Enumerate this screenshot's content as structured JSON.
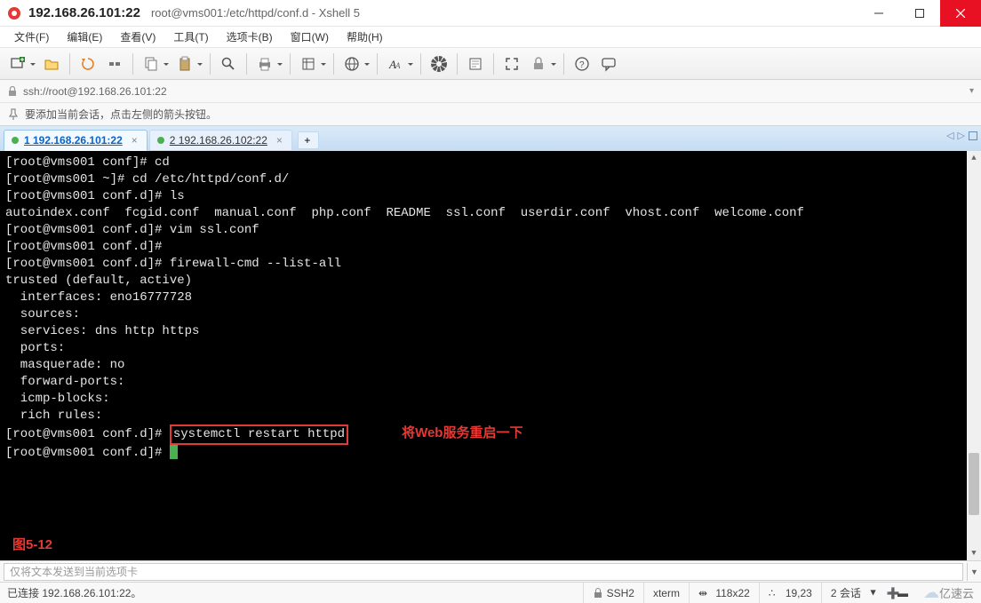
{
  "title_bar": {
    "host": "192.168.26.101:22",
    "subtitle": "root@vms001:/etc/httpd/conf.d - Xshell 5"
  },
  "menu": {
    "file": "文件(F)",
    "edit": "编辑(E)",
    "view": "查看(V)",
    "tools": "工具(T)",
    "tabs": "选项卡(B)",
    "window": "窗口(W)",
    "help": "帮助(H)"
  },
  "address": "ssh://root@192.168.26.101:22",
  "hint": "要添加当前会话，点击左侧的箭头按钮。",
  "tabs": {
    "active": "1 192.168.26.101:22",
    "inactive": "2 192.168.26.102:22",
    "add": "+"
  },
  "terminal": {
    "l1": "[root@vms001 conf]# cd",
    "l2": "[root@vms001 ~]# cd /etc/httpd/conf.d/",
    "l3": "[root@vms001 conf.d]# ls",
    "l4": "autoindex.conf  fcgid.conf  manual.conf  php.conf  README  ssl.conf  userdir.conf  vhost.conf  welcome.conf",
    "l5": "[root@vms001 conf.d]# vim ssl.conf",
    "l6": "[root@vms001 conf.d]# ",
    "l7": "[root@vms001 conf.d]# firewall-cmd --list-all",
    "l8": "trusted (default, active)",
    "l9": "  interfaces: eno16777728",
    "l10": "  sources: ",
    "l11": "  services: dns http https",
    "l12": "  ports: ",
    "l13": "  masquerade: no",
    "l14": "  forward-ports: ",
    "l15": "  icmp-blocks: ",
    "l16": "  rich rules: ",
    "l17": "",
    "l18_prompt": "[root@vms001 conf.d]# ",
    "l18_cmd": "systemctl restart httpd",
    "l18_note": "将Web服务重启一下",
    "l19": "[root@vms001 conf.d]# ",
    "fig": "图5-12"
  },
  "send_placeholder": "仅将文本发送到当前选项卡",
  "status": {
    "conn": "已连接 192.168.26.101:22。",
    "proto": "SSH2",
    "term": "xterm",
    "size": "118x22",
    "pos": "19,23",
    "sess": "2 会话",
    "brand": "亿速云"
  }
}
